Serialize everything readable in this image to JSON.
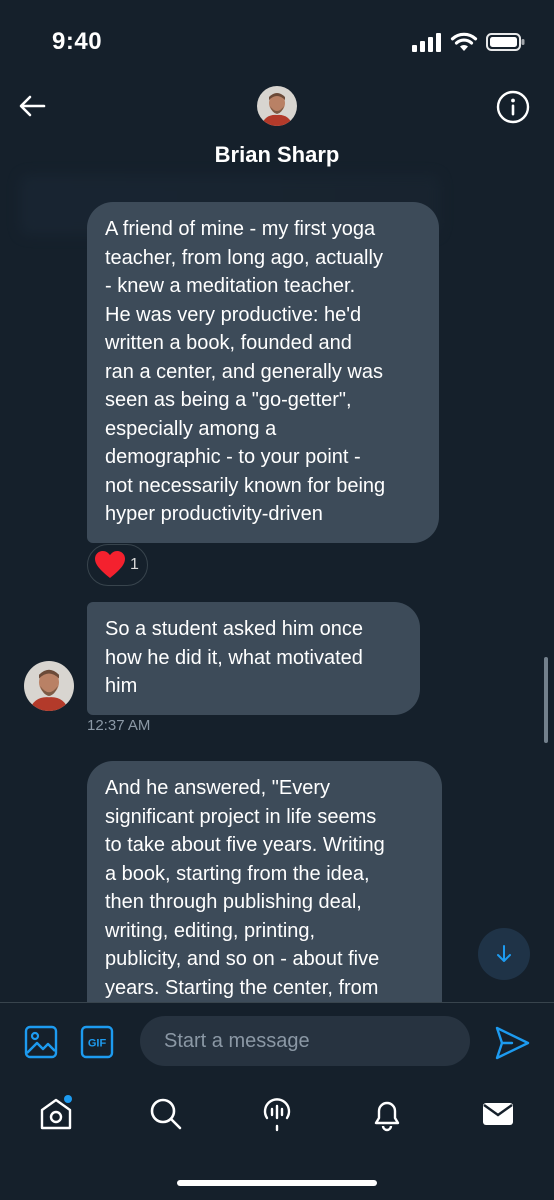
{
  "status_bar": {
    "time": "9:40"
  },
  "header": {
    "name": "Brian Sharp"
  },
  "messages": [
    {
      "text": "A friend of mine - my first yoga\nteacher, from long ago, actually\n- knew a meditation teacher.\nHe was very productive: he'd\nwritten a book, founded and\nran a center, and generally was\nseen as being a \"go-getter\",\nespecially among a\ndemographic - to your point -\nnot necessarily known for being\nhyper productivity-driven",
      "reaction": {
        "emoji": "heart",
        "count": "1"
      }
    },
    {
      "text": "So a student asked him once\nhow he did it, what motivated\nhim",
      "timestamp": "12:37 AM"
    },
    {
      "text": "And he answered, \"Every\nsignificant project in life seems\nto take about five years. Writing\na book, starting from the idea,\nthen through publishing deal,\nwriting, editing, printing,\npublicity, and so on - about five\nyears. Starting the center, from"
    }
  ],
  "composer": {
    "placeholder": "Start a message",
    "gif_label": "GIF"
  },
  "colors": {
    "background": "#15202b",
    "bubble": "#3d4b59",
    "accent": "#1d9bf0",
    "heart": "#f4212e"
  },
  "tabs": [
    "home-icon",
    "search-icon",
    "spaces-icon",
    "notifications-icon",
    "messages-icon"
  ]
}
